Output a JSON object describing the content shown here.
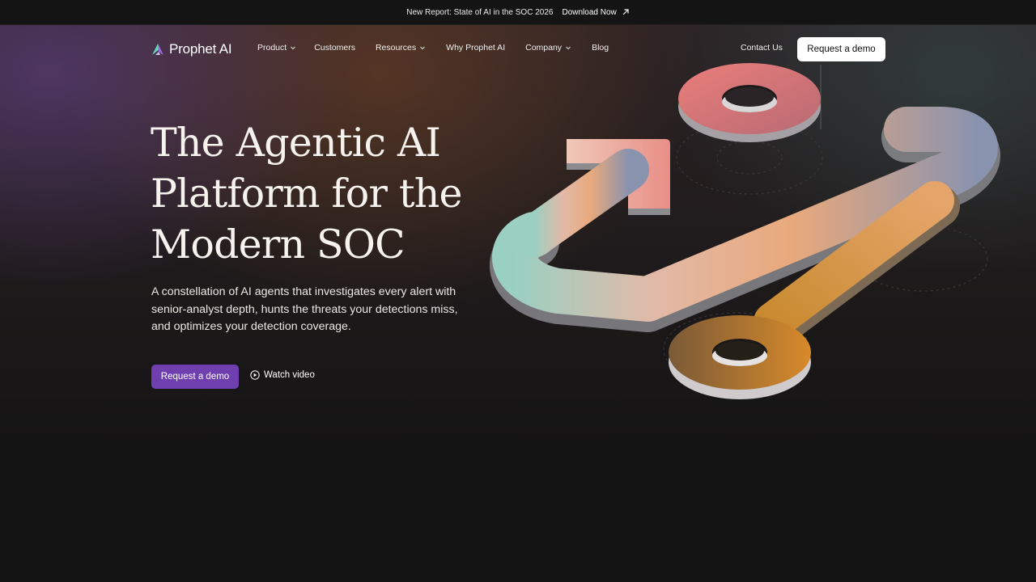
{
  "announcement": {
    "text": "New Report: State of AI in the SOC 2026",
    "link_label": "Download Now"
  },
  "nav": {
    "brand": "Prophet AI",
    "items": [
      {
        "label": "Product",
        "dropdown": true
      },
      {
        "label": "Customers",
        "dropdown": false
      },
      {
        "label": "Resources",
        "dropdown": true
      },
      {
        "label": "Why Prophet AI",
        "dropdown": false
      },
      {
        "label": "Company",
        "dropdown": true
      },
      {
        "label": "Blog",
        "dropdown": false
      }
    ],
    "contact_label": "Contact Us",
    "cta_label": "Request a demo"
  },
  "hero": {
    "headline_lines": [
      "The Agentic AI",
      "Platform for the",
      "Modern SOC"
    ],
    "subtitle": "A constellation of AI agents that investigates every alert with senior-analyst depth, hunts the threats your detections miss, and optimizes your detection coverage.",
    "primary_cta": "Request a demo",
    "secondary_cta": "Watch video"
  },
  "colors": {
    "brand_purple": "#6f3fb0",
    "background": "#141414",
    "ring_top": "#e27a75",
    "ring_bottom": "#c9822e",
    "logo_teal": "#66d6b8",
    "logo_purple": "#9a6be0"
  },
  "icons": {
    "logo": "prophet-logo-icon",
    "external_link": "arrow-up-right-icon",
    "dropdown": "chevron-down-icon",
    "play": "play-circle-icon"
  }
}
